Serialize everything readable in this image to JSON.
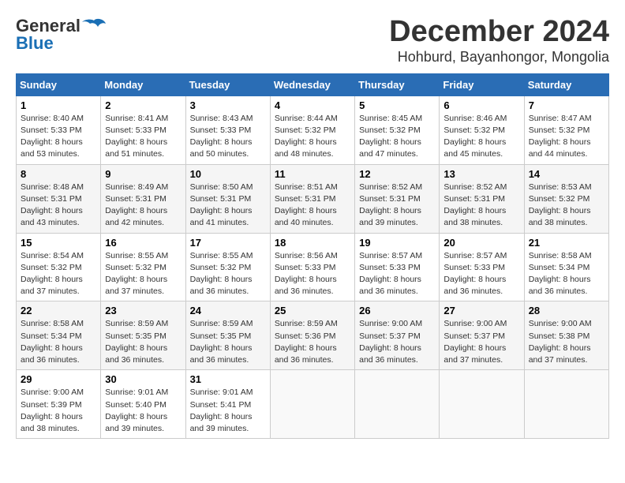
{
  "header": {
    "logo_general": "General",
    "logo_blue": "Blue",
    "month_title": "December 2024",
    "subtitle": "Hohburd, Bayanhongor, Mongolia"
  },
  "weekdays": [
    "Sunday",
    "Monday",
    "Tuesday",
    "Wednesday",
    "Thursday",
    "Friday",
    "Saturday"
  ],
  "weeks": [
    [
      {
        "day": "1",
        "sunrise": "Sunrise: 8:40 AM",
        "sunset": "Sunset: 5:33 PM",
        "daylight": "Daylight: 8 hours and 53 minutes."
      },
      {
        "day": "2",
        "sunrise": "Sunrise: 8:41 AM",
        "sunset": "Sunset: 5:33 PM",
        "daylight": "Daylight: 8 hours and 51 minutes."
      },
      {
        "day": "3",
        "sunrise": "Sunrise: 8:43 AM",
        "sunset": "Sunset: 5:33 PM",
        "daylight": "Daylight: 8 hours and 50 minutes."
      },
      {
        "day": "4",
        "sunrise": "Sunrise: 8:44 AM",
        "sunset": "Sunset: 5:32 PM",
        "daylight": "Daylight: 8 hours and 48 minutes."
      },
      {
        "day": "5",
        "sunrise": "Sunrise: 8:45 AM",
        "sunset": "Sunset: 5:32 PM",
        "daylight": "Daylight: 8 hours and 47 minutes."
      },
      {
        "day": "6",
        "sunrise": "Sunrise: 8:46 AM",
        "sunset": "Sunset: 5:32 PM",
        "daylight": "Daylight: 8 hours and 45 minutes."
      },
      {
        "day": "7",
        "sunrise": "Sunrise: 8:47 AM",
        "sunset": "Sunset: 5:32 PM",
        "daylight": "Daylight: 8 hours and 44 minutes."
      }
    ],
    [
      {
        "day": "8",
        "sunrise": "Sunrise: 8:48 AM",
        "sunset": "Sunset: 5:31 PM",
        "daylight": "Daylight: 8 hours and 43 minutes."
      },
      {
        "day": "9",
        "sunrise": "Sunrise: 8:49 AM",
        "sunset": "Sunset: 5:31 PM",
        "daylight": "Daylight: 8 hours and 42 minutes."
      },
      {
        "day": "10",
        "sunrise": "Sunrise: 8:50 AM",
        "sunset": "Sunset: 5:31 PM",
        "daylight": "Daylight: 8 hours and 41 minutes."
      },
      {
        "day": "11",
        "sunrise": "Sunrise: 8:51 AM",
        "sunset": "Sunset: 5:31 PM",
        "daylight": "Daylight: 8 hours and 40 minutes."
      },
      {
        "day": "12",
        "sunrise": "Sunrise: 8:52 AM",
        "sunset": "Sunset: 5:31 PM",
        "daylight": "Daylight: 8 hours and 39 minutes."
      },
      {
        "day": "13",
        "sunrise": "Sunrise: 8:52 AM",
        "sunset": "Sunset: 5:31 PM",
        "daylight": "Daylight: 8 hours and 38 minutes."
      },
      {
        "day": "14",
        "sunrise": "Sunrise: 8:53 AM",
        "sunset": "Sunset: 5:32 PM",
        "daylight": "Daylight: 8 hours and 38 minutes."
      }
    ],
    [
      {
        "day": "15",
        "sunrise": "Sunrise: 8:54 AM",
        "sunset": "Sunset: 5:32 PM",
        "daylight": "Daylight: 8 hours and 37 minutes."
      },
      {
        "day": "16",
        "sunrise": "Sunrise: 8:55 AM",
        "sunset": "Sunset: 5:32 PM",
        "daylight": "Daylight: 8 hours and 37 minutes."
      },
      {
        "day": "17",
        "sunrise": "Sunrise: 8:55 AM",
        "sunset": "Sunset: 5:32 PM",
        "daylight": "Daylight: 8 hours and 36 minutes."
      },
      {
        "day": "18",
        "sunrise": "Sunrise: 8:56 AM",
        "sunset": "Sunset: 5:33 PM",
        "daylight": "Daylight: 8 hours and 36 minutes."
      },
      {
        "day": "19",
        "sunrise": "Sunrise: 8:57 AM",
        "sunset": "Sunset: 5:33 PM",
        "daylight": "Daylight: 8 hours and 36 minutes."
      },
      {
        "day": "20",
        "sunrise": "Sunrise: 8:57 AM",
        "sunset": "Sunset: 5:33 PM",
        "daylight": "Daylight: 8 hours and 36 minutes."
      },
      {
        "day": "21",
        "sunrise": "Sunrise: 8:58 AM",
        "sunset": "Sunset: 5:34 PM",
        "daylight": "Daylight: 8 hours and 36 minutes."
      }
    ],
    [
      {
        "day": "22",
        "sunrise": "Sunrise: 8:58 AM",
        "sunset": "Sunset: 5:34 PM",
        "daylight": "Daylight: 8 hours and 36 minutes."
      },
      {
        "day": "23",
        "sunrise": "Sunrise: 8:59 AM",
        "sunset": "Sunset: 5:35 PM",
        "daylight": "Daylight: 8 hours and 36 minutes."
      },
      {
        "day": "24",
        "sunrise": "Sunrise: 8:59 AM",
        "sunset": "Sunset: 5:35 PM",
        "daylight": "Daylight: 8 hours and 36 minutes."
      },
      {
        "day": "25",
        "sunrise": "Sunrise: 8:59 AM",
        "sunset": "Sunset: 5:36 PM",
        "daylight": "Daylight: 8 hours and 36 minutes."
      },
      {
        "day": "26",
        "sunrise": "Sunrise: 9:00 AM",
        "sunset": "Sunset: 5:37 PM",
        "daylight": "Daylight: 8 hours and 36 minutes."
      },
      {
        "day": "27",
        "sunrise": "Sunrise: 9:00 AM",
        "sunset": "Sunset: 5:37 PM",
        "daylight": "Daylight: 8 hours and 37 minutes."
      },
      {
        "day": "28",
        "sunrise": "Sunrise: 9:00 AM",
        "sunset": "Sunset: 5:38 PM",
        "daylight": "Daylight: 8 hours and 37 minutes."
      }
    ],
    [
      {
        "day": "29",
        "sunrise": "Sunrise: 9:00 AM",
        "sunset": "Sunset: 5:39 PM",
        "daylight": "Daylight: 8 hours and 38 minutes."
      },
      {
        "day": "30",
        "sunrise": "Sunrise: 9:01 AM",
        "sunset": "Sunset: 5:40 PM",
        "daylight": "Daylight: 8 hours and 39 minutes."
      },
      {
        "day": "31",
        "sunrise": "Sunrise: 9:01 AM",
        "sunset": "Sunset: 5:41 PM",
        "daylight": "Daylight: 8 hours and 39 minutes."
      },
      null,
      null,
      null,
      null
    ]
  ]
}
